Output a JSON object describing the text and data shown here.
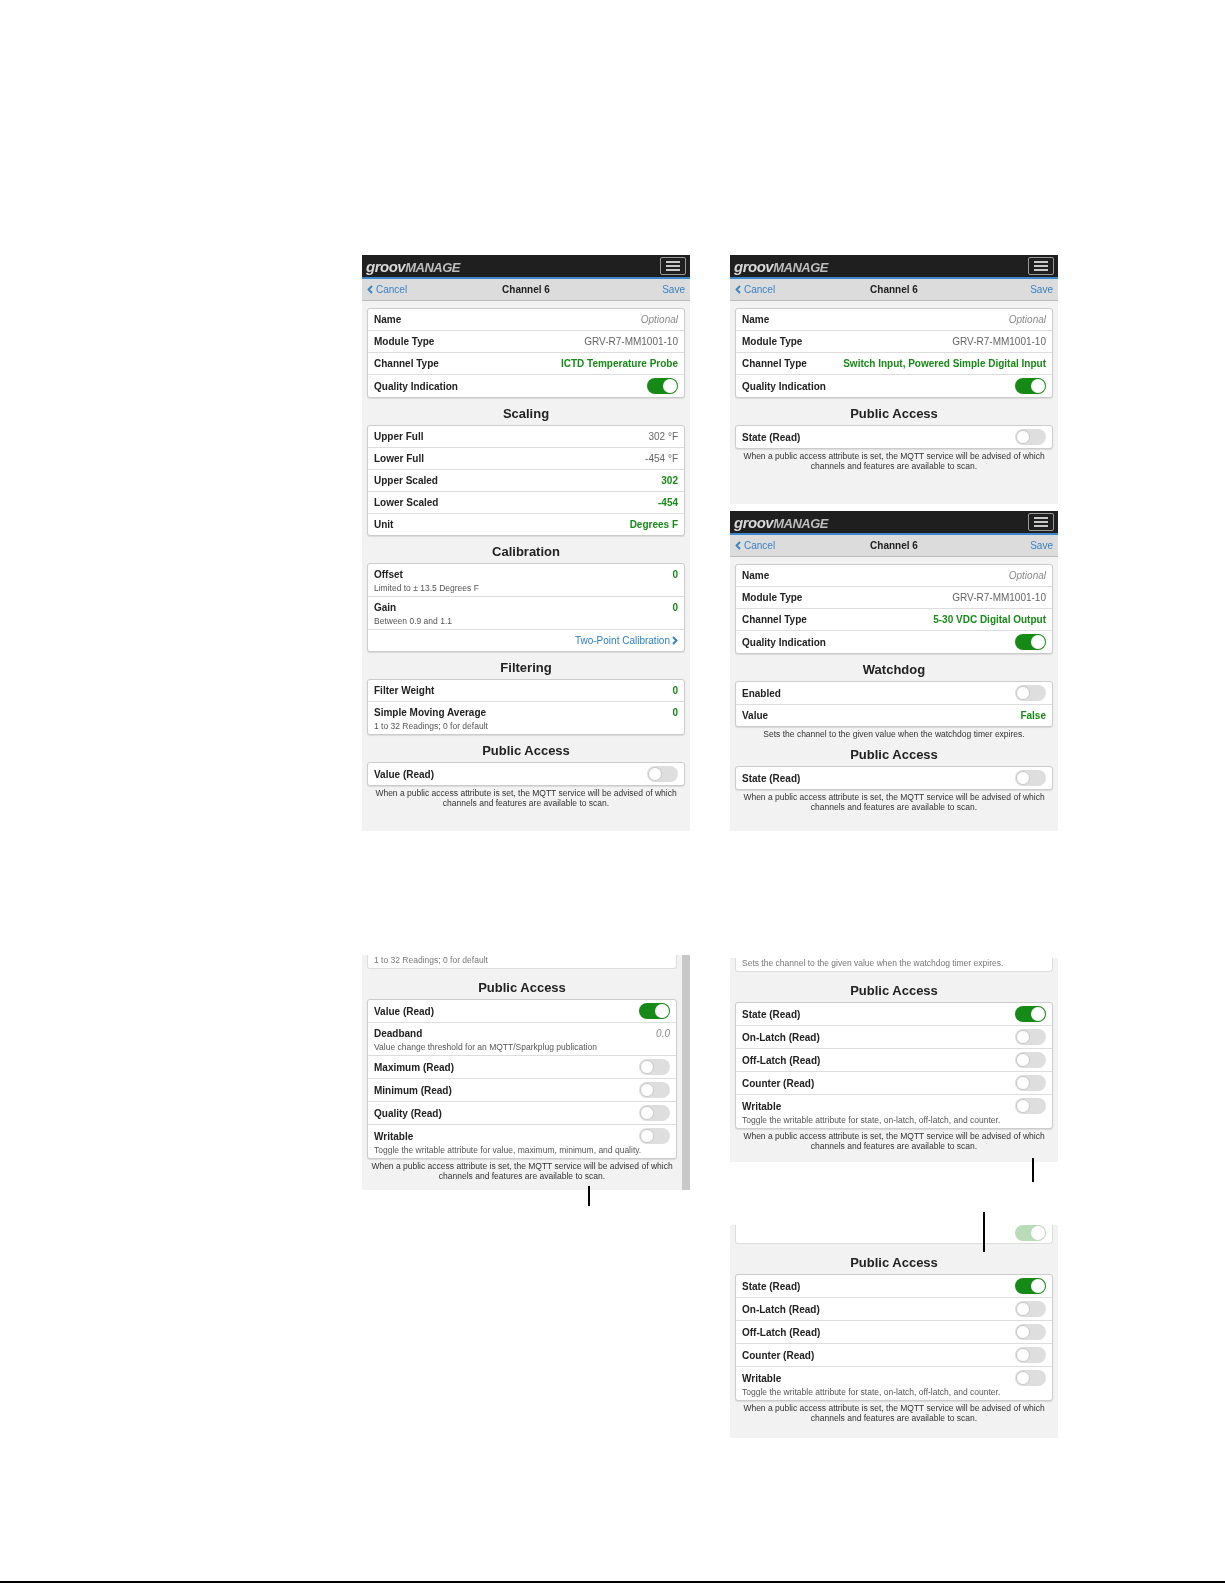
{
  "rows": [
    {
      "left": [
        {
          "header": {
            "logo": [
              "groov",
              "MANAGE"
            ],
            "back": "Cancel",
            "title": "Channel 6",
            "action": "Save"
          },
          "sections": [
            {
              "rows": [
                {
                  "kind": "placeholder",
                  "label": "Name",
                  "value": "Optional"
                },
                {
                  "kind": "text",
                  "label": "Module Type",
                  "value": "GRV-R7-MM1001-10"
                },
                {
                  "kind": "setting",
                  "label": "Channel Type",
                  "value": "ICTD Temperature Probe"
                },
                {
                  "kind": "toggle",
                  "label": "Quality Indication",
                  "on": true
                }
              ]
            },
            {
              "heading": "Scaling",
              "rows": [
                {
                  "kind": "text",
                  "label": "Upper Full",
                  "value": "302 °F"
                },
                {
                  "kind": "text",
                  "label": "Lower Full",
                  "value": "-454 °F"
                },
                {
                  "kind": "setting",
                  "label": "Upper Scaled",
                  "value": "302"
                },
                {
                  "kind": "setting",
                  "label": "Lower Scaled",
                  "value": "-454"
                },
                {
                  "kind": "setting",
                  "label": "Unit",
                  "value": "Degrees F"
                }
              ]
            },
            {
              "heading": "Calibration",
              "rows": [
                {
                  "kind": "setting",
                  "label": "Offset",
                  "value": "0",
                  "hint": "Limited to ± 13.5 Degrees F"
                },
                {
                  "kind": "setting",
                  "label": "Gain",
                  "value": "0",
                  "hint": "Between 0.9 and 1.1"
                },
                {
                  "kind": "link",
                  "label": "Two-Point Calibration"
                }
              ]
            },
            {
              "heading": "Filtering",
              "rows": [
                {
                  "kind": "setting",
                  "label": "Filter Weight",
                  "value": "0"
                },
                {
                  "kind": "setting",
                  "label": "Simple Moving Average",
                  "value": "0",
                  "hint": "1 to 32 Readings; 0 for default"
                }
              ]
            },
            {
              "heading": "Public Access",
              "rows": [
                {
                  "kind": "toggle",
                  "label": "Value (Read)",
                  "on": false
                }
              ],
              "note": "When a public access attribute is set, the MQTT service will be advised of which channels and features are available to scan."
            }
          ]
        }
      ],
      "right": [
        {
          "header": {
            "logo": [
              "groov",
              "MANAGE"
            ],
            "back": "Cancel",
            "title": "Channel 6",
            "action": "Save"
          },
          "sections": [
            {
              "rows": [
                {
                  "kind": "placeholder",
                  "label": "Name",
                  "value": "Optional"
                },
                {
                  "kind": "text",
                  "label": "Module Type",
                  "value": "GRV-R7-MM1001-10"
                },
                {
                  "kind": "setting",
                  "label": "Channel Type",
                  "value": "Switch Input, Powered Simple Digital Input"
                },
                {
                  "kind": "toggle",
                  "label": "Quality Indication",
                  "on": true
                }
              ]
            },
            {
              "heading": "Public Access",
              "rows": [
                {
                  "kind": "toggle",
                  "label": "State (Read)",
                  "on": false
                }
              ],
              "note": "When a public access attribute is set, the MQTT service will be advised of which channels and features are available to scan."
            }
          ]
        },
        {
          "header": {
            "logo": [
              "groov",
              "MANAGE"
            ],
            "back": "Cancel",
            "title": "Channel 6",
            "action": "Save"
          },
          "sections": [
            {
              "rows": [
                {
                  "kind": "placeholder",
                  "label": "Name",
                  "value": "Optional"
                },
                {
                  "kind": "text",
                  "label": "Module Type",
                  "value": "GRV-R7-MM1001-10"
                },
                {
                  "kind": "setting",
                  "label": "Channel Type",
                  "value": "5-30 VDC Digital Output"
                },
                {
                  "kind": "toggle",
                  "label": "Quality Indication",
                  "on": true
                }
              ]
            },
            {
              "heading": "Watchdog",
              "rows": [
                {
                  "kind": "toggle",
                  "label": "Enabled",
                  "on": false
                },
                {
                  "kind": "setting",
                  "label": "Value",
                  "value": "False"
                }
              ],
              "note": "Sets the channel to the given value when the watchdog timer expires."
            },
            {
              "heading": "Public Access",
              "rows": [
                {
                  "kind": "toggle",
                  "label": "State (Read)",
                  "on": false
                }
              ],
              "note": "When a public access attribute is set, the MQTT service will be advised of which channels and features are available to scan."
            }
          ]
        }
      ]
    },
    {
      "left": [
        {
          "fragment": {
            "text": "1 to 32 Readings; 0 for default"
          },
          "sections": [
            {
              "heading": "Public Access",
              "rows": [
                {
                  "kind": "toggle",
                  "label": "Value (Read)",
                  "on": true
                },
                {
                  "kind": "placeholder",
                  "label": "Deadband",
                  "value": "0.0",
                  "hint": "Value change threshold for an MQTT/Sparkplug publication"
                },
                {
                  "kind": "toggle",
                  "label": "Maximum (Read)",
                  "on": false
                },
                {
                  "kind": "toggle",
                  "label": "Minimum (Read)",
                  "on": false
                },
                {
                  "kind": "toggle",
                  "label": "Quality (Read)",
                  "on": false
                },
                {
                  "kind": "toggle",
                  "label": "Writable",
                  "on": false,
                  "hint": "Toggle the writable attribute for value, maximum, minimum, and quality."
                }
              ],
              "note": "When a public access attribute is set, the MQTT service will be advised of which channels and features are available to scan."
            }
          ]
        }
      ],
      "right": [
        {
          "fragment": {
            "text": "Sets the channel to the given value when the watchdog timer expires."
          },
          "sections": [
            {
              "heading": "Public Access",
              "rows": [
                {
                  "kind": "toggle",
                  "label": "State (Read)",
                  "on": true
                },
                {
                  "kind": "toggle",
                  "label": "On-Latch (Read)",
                  "on": false
                },
                {
                  "kind": "toggle",
                  "label": "Off-Latch (Read)",
                  "on": false
                },
                {
                  "kind": "toggle",
                  "label": "Counter (Read)",
                  "on": false
                },
                {
                  "kind": "toggle",
                  "label": "Writable",
                  "on": false,
                  "hint": "Toggle the writable attribute for state, on-latch, off-latch, and counter."
                }
              ],
              "note": "When a public access attribute is set, the MQTT service will be advised of which channels and features are available to scan."
            }
          ]
        },
        {
          "fragment": {
            "on": true
          },
          "sections": [
            {
              "heading": "Public Access",
              "rows": [
                {
                  "kind": "toggle",
                  "label": "State (Read)",
                  "on": true
                },
                {
                  "kind": "toggle",
                  "label": "On-Latch (Read)",
                  "on": false
                },
                {
                  "kind": "toggle",
                  "label": "Off-Latch (Read)",
                  "on": false
                },
                {
                  "kind": "toggle",
                  "label": "Counter (Read)",
                  "on": false
                },
                {
                  "kind": "toggle",
                  "label": "Writable",
                  "on": false,
                  "hint": "Toggle the writable attribute for state, on-latch, off-latch, and counter."
                }
              ],
              "note": "When a public access attribute is set, the MQTT service will be advised of which channels and features are available to scan."
            }
          ]
        }
      ]
    }
  ]
}
